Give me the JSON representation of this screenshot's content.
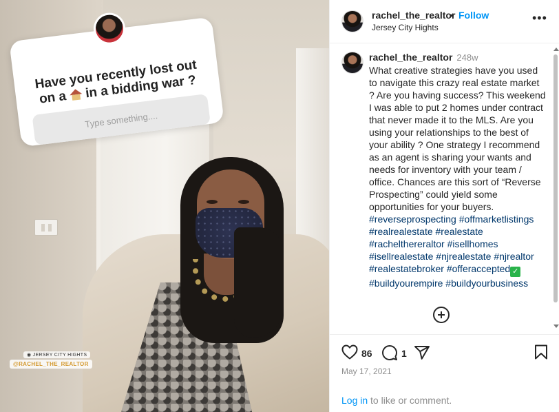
{
  "photo": {
    "sticker_question": "Have you recently lost out on a 🏠 in a bidding war ?",
    "sticker_question_before": "Have you recently lost out on a",
    "sticker_question_after": "in a bidding war ?",
    "sticker_placeholder": "Type something....",
    "location_tag": "◉ JERSEY CITY HIGHTS",
    "mention_tag": "@RACHEL_THE_REALTOR"
  },
  "header": {
    "username": "rachel_the_realtor",
    "separator": "•",
    "follow_label": "Follow",
    "location": "Jersey City Hights",
    "more_label": "•••"
  },
  "caption": {
    "username": "rachel_the_realtor",
    "time": "248w",
    "text": "What creative strategies have you used to navigate this crazy real estate market ? Are you having success? This weekend I was able to put 2 homes under contract that never made it to the MLS. Are you using your relationships to the best of your ability ? One strategy I recommend as an agent is sharing your wants and needs for inventory with your team / office. Chances are this sort of “Reverse Prospecting” could yield some opportunities for your buyers.",
    "hashtags": [
      "#reverseprospecting",
      "#offmarketlistings",
      "#realrealestate",
      "#realestate",
      "#rachelthereraltor",
      "#isellhomes",
      "#isellrealestate",
      "#njrealestate",
      "#njrealtor",
      "#realestatebroker",
      "#offeraccepted",
      "#buildyourempire",
      "#buildyourbusiness"
    ],
    "check_emoji": "✓"
  },
  "actions": {
    "like_count": "86",
    "comment_count": "1",
    "date": "May 17, 2021",
    "login_link": "Log in",
    "login_suffix": " to like or comment."
  },
  "icons": {
    "like": "heart-icon",
    "comment": "comment-icon",
    "share": "share-icon",
    "save": "bookmark-icon",
    "more": "more-icon",
    "load_more": "plus-circle-icon"
  },
  "colors": {
    "link_blue": "#0095f6",
    "hashtag": "#00376b",
    "muted": "#8e8e8e",
    "text": "#262626"
  }
}
